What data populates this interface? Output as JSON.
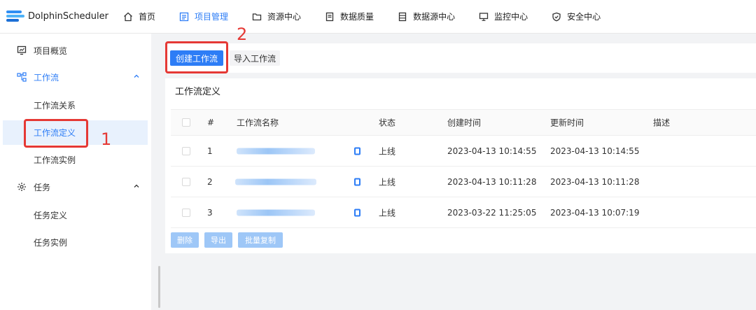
{
  "app": {
    "name": "DolphinScheduler"
  },
  "topnav": [
    {
      "label": "首页",
      "icon": "home-icon",
      "active": false
    },
    {
      "label": "项目管理",
      "icon": "project-icon",
      "active": true
    },
    {
      "label": "资源中心",
      "icon": "folder-icon",
      "active": false
    },
    {
      "label": "数据质量",
      "icon": "document-icon",
      "active": false
    },
    {
      "label": "数据源中心",
      "icon": "datasource-icon",
      "active": false
    },
    {
      "label": "监控中心",
      "icon": "monitor-icon",
      "active": false
    },
    {
      "label": "安全中心",
      "icon": "shield-icon",
      "active": false
    }
  ],
  "sidebar": {
    "overview": "项目概览",
    "workflow": {
      "label": "工作流",
      "children": [
        "工作流关系",
        "工作流定义",
        "工作流实例"
      ]
    },
    "task": {
      "label": "任务",
      "children": [
        "任务定义",
        "任务实例"
      ]
    },
    "selected": "工作流定义"
  },
  "toolbar": {
    "create": "创建工作流",
    "import": "导入工作流"
  },
  "card": {
    "title": "工作流定义"
  },
  "table": {
    "columns": [
      "#",
      "工作流名称",
      "状态",
      "创建时间",
      "更新时间",
      "描述"
    ],
    "rows": [
      {
        "num": "1",
        "status": "上线",
        "created": "2023-04-13 10:14:55",
        "updated": "2023-04-13 10:14:55",
        "desc": ""
      },
      {
        "num": "2",
        "status": "上线",
        "created": "2023-04-13 10:11:28",
        "updated": "2023-04-13 10:11:28",
        "desc": ""
      },
      {
        "num": "3",
        "status": "上线",
        "created": "2023-03-22 11:25:05",
        "updated": "2023-04-13 10:07:19",
        "desc": ""
      }
    ]
  },
  "bulk_actions": {
    "delete": "删除",
    "export": "导出",
    "batch_copy": "批量复制"
  },
  "annotations": {
    "one": "1",
    "two": "2"
  },
  "colors": {
    "primary": "#2d7df6",
    "annotation": "#e53935",
    "selected_bg": "#e8f1fd"
  }
}
